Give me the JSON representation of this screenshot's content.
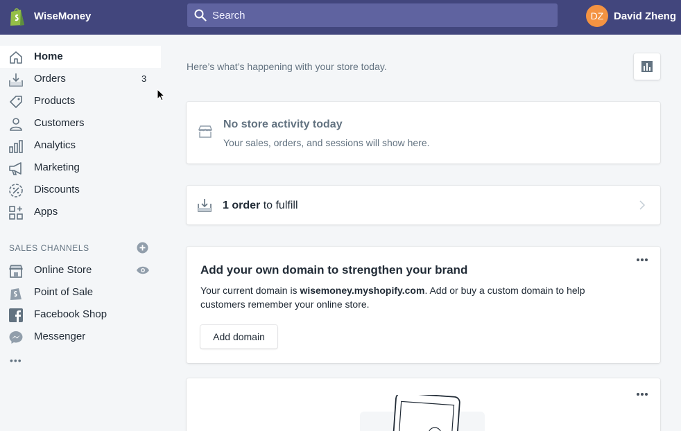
{
  "topbar": {
    "store_name": "WiseMoney",
    "search_placeholder": "Search",
    "user_initials": "DZ",
    "user_name": "David Zheng"
  },
  "sidebar": {
    "items": [
      {
        "label": "Home",
        "icon": "home-icon",
        "active": true
      },
      {
        "label": "Orders",
        "icon": "orders-icon",
        "badge": "3"
      },
      {
        "label": "Products",
        "icon": "tag-icon"
      },
      {
        "label": "Customers",
        "icon": "person-icon"
      },
      {
        "label": "Analytics",
        "icon": "bar-chart-icon"
      },
      {
        "label": "Marketing",
        "icon": "megaphone-icon"
      },
      {
        "label": "Discounts",
        "icon": "discount-icon"
      },
      {
        "label": "Apps",
        "icon": "apps-icon"
      }
    ],
    "sales_channels_title": "SALES CHANNELS",
    "channels": [
      {
        "label": "Online Store",
        "icon": "store-icon"
      },
      {
        "label": "Point of Sale",
        "icon": "pos-icon"
      },
      {
        "label": "Facebook Shop",
        "icon": "facebook-icon"
      },
      {
        "label": "Messenger",
        "icon": "messenger-icon"
      }
    ],
    "more": "•••"
  },
  "main": {
    "intro": "Here’s what’s happening with your store today.",
    "activity_card": {
      "title": "No store activity today",
      "subtitle": "Your sales, orders, and sessions will show here."
    },
    "orders_card": {
      "count_text": "1 order",
      "rest_text": " to fulfill"
    },
    "domain_card": {
      "title": "Add your own domain to strengthen your brand",
      "body_prefix": "Your current domain is ",
      "domain": "wisemoney.myshopify.com",
      "body_suffix": ". Add or buy a custom domain to help customers remember your online store.",
      "button": "Add domain"
    }
  },
  "colors": {
    "topbar": "#42467d",
    "search_bg": "#5f63a0",
    "avatar": "#f49342",
    "page_bg": "#f4f6f8",
    "text_muted": "#637381"
  }
}
